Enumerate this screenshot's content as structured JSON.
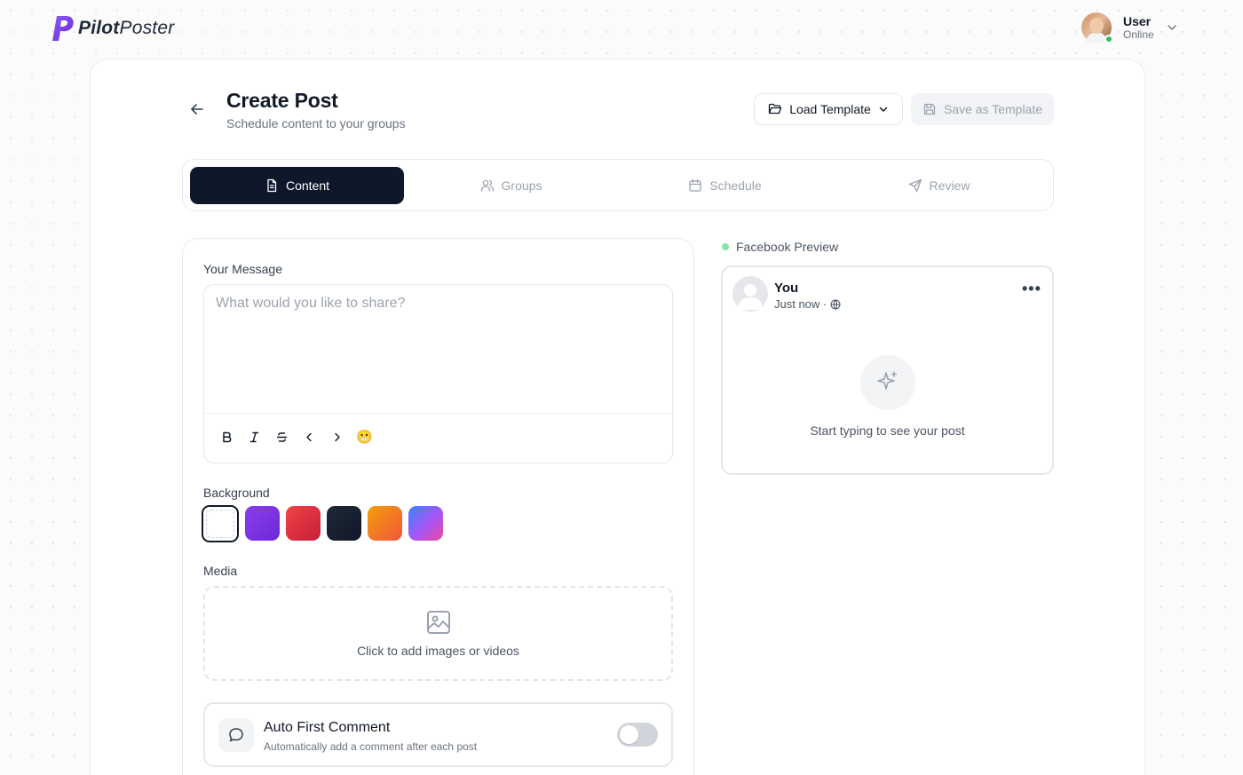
{
  "brand": {
    "name_bold": "Pilot",
    "name_light": "Poster",
    "color": "#7c3aed"
  },
  "user": {
    "name": "User",
    "status": "Online"
  },
  "header": {
    "title": "Create Post",
    "subtitle": "Schedule content to your groups",
    "load_template": "Load Template",
    "save_template": "Save as Template"
  },
  "tabs": [
    {
      "label": "Content",
      "icon": "file-icon",
      "active": true
    },
    {
      "label": "Groups",
      "icon": "users-icon",
      "active": false
    },
    {
      "label": "Schedule",
      "icon": "calendar-icon",
      "active": false
    },
    {
      "label": "Review",
      "icon": "send-icon",
      "active": false
    }
  ],
  "message": {
    "label": "Your Message",
    "placeholder": "What would you like to share?",
    "value": "",
    "toolbar": [
      "bold",
      "italic",
      "strikethrough",
      "previous",
      "next",
      "emoji"
    ],
    "emoji": "😬"
  },
  "background": {
    "label": "Background",
    "options": [
      {
        "name": "none",
        "color": "#ffffff",
        "selected": true
      },
      {
        "name": "purple",
        "color": "#7c3aed"
      },
      {
        "name": "red",
        "color": "#dc2626"
      },
      {
        "name": "dark",
        "color": "#1f2937"
      },
      {
        "name": "orange",
        "color": "#f97316"
      },
      {
        "name": "gradient",
        "color": "#6366f1"
      }
    ]
  },
  "media": {
    "label": "Media",
    "hint": "Click to add images or videos"
  },
  "auto_comment": {
    "title": "Auto First Comment",
    "subtitle": "Automatically add a comment after each post",
    "enabled": false
  },
  "preview": {
    "label": "Facebook Preview",
    "author": "You",
    "time": "Just now ·",
    "empty": "Start typing to see your post"
  }
}
